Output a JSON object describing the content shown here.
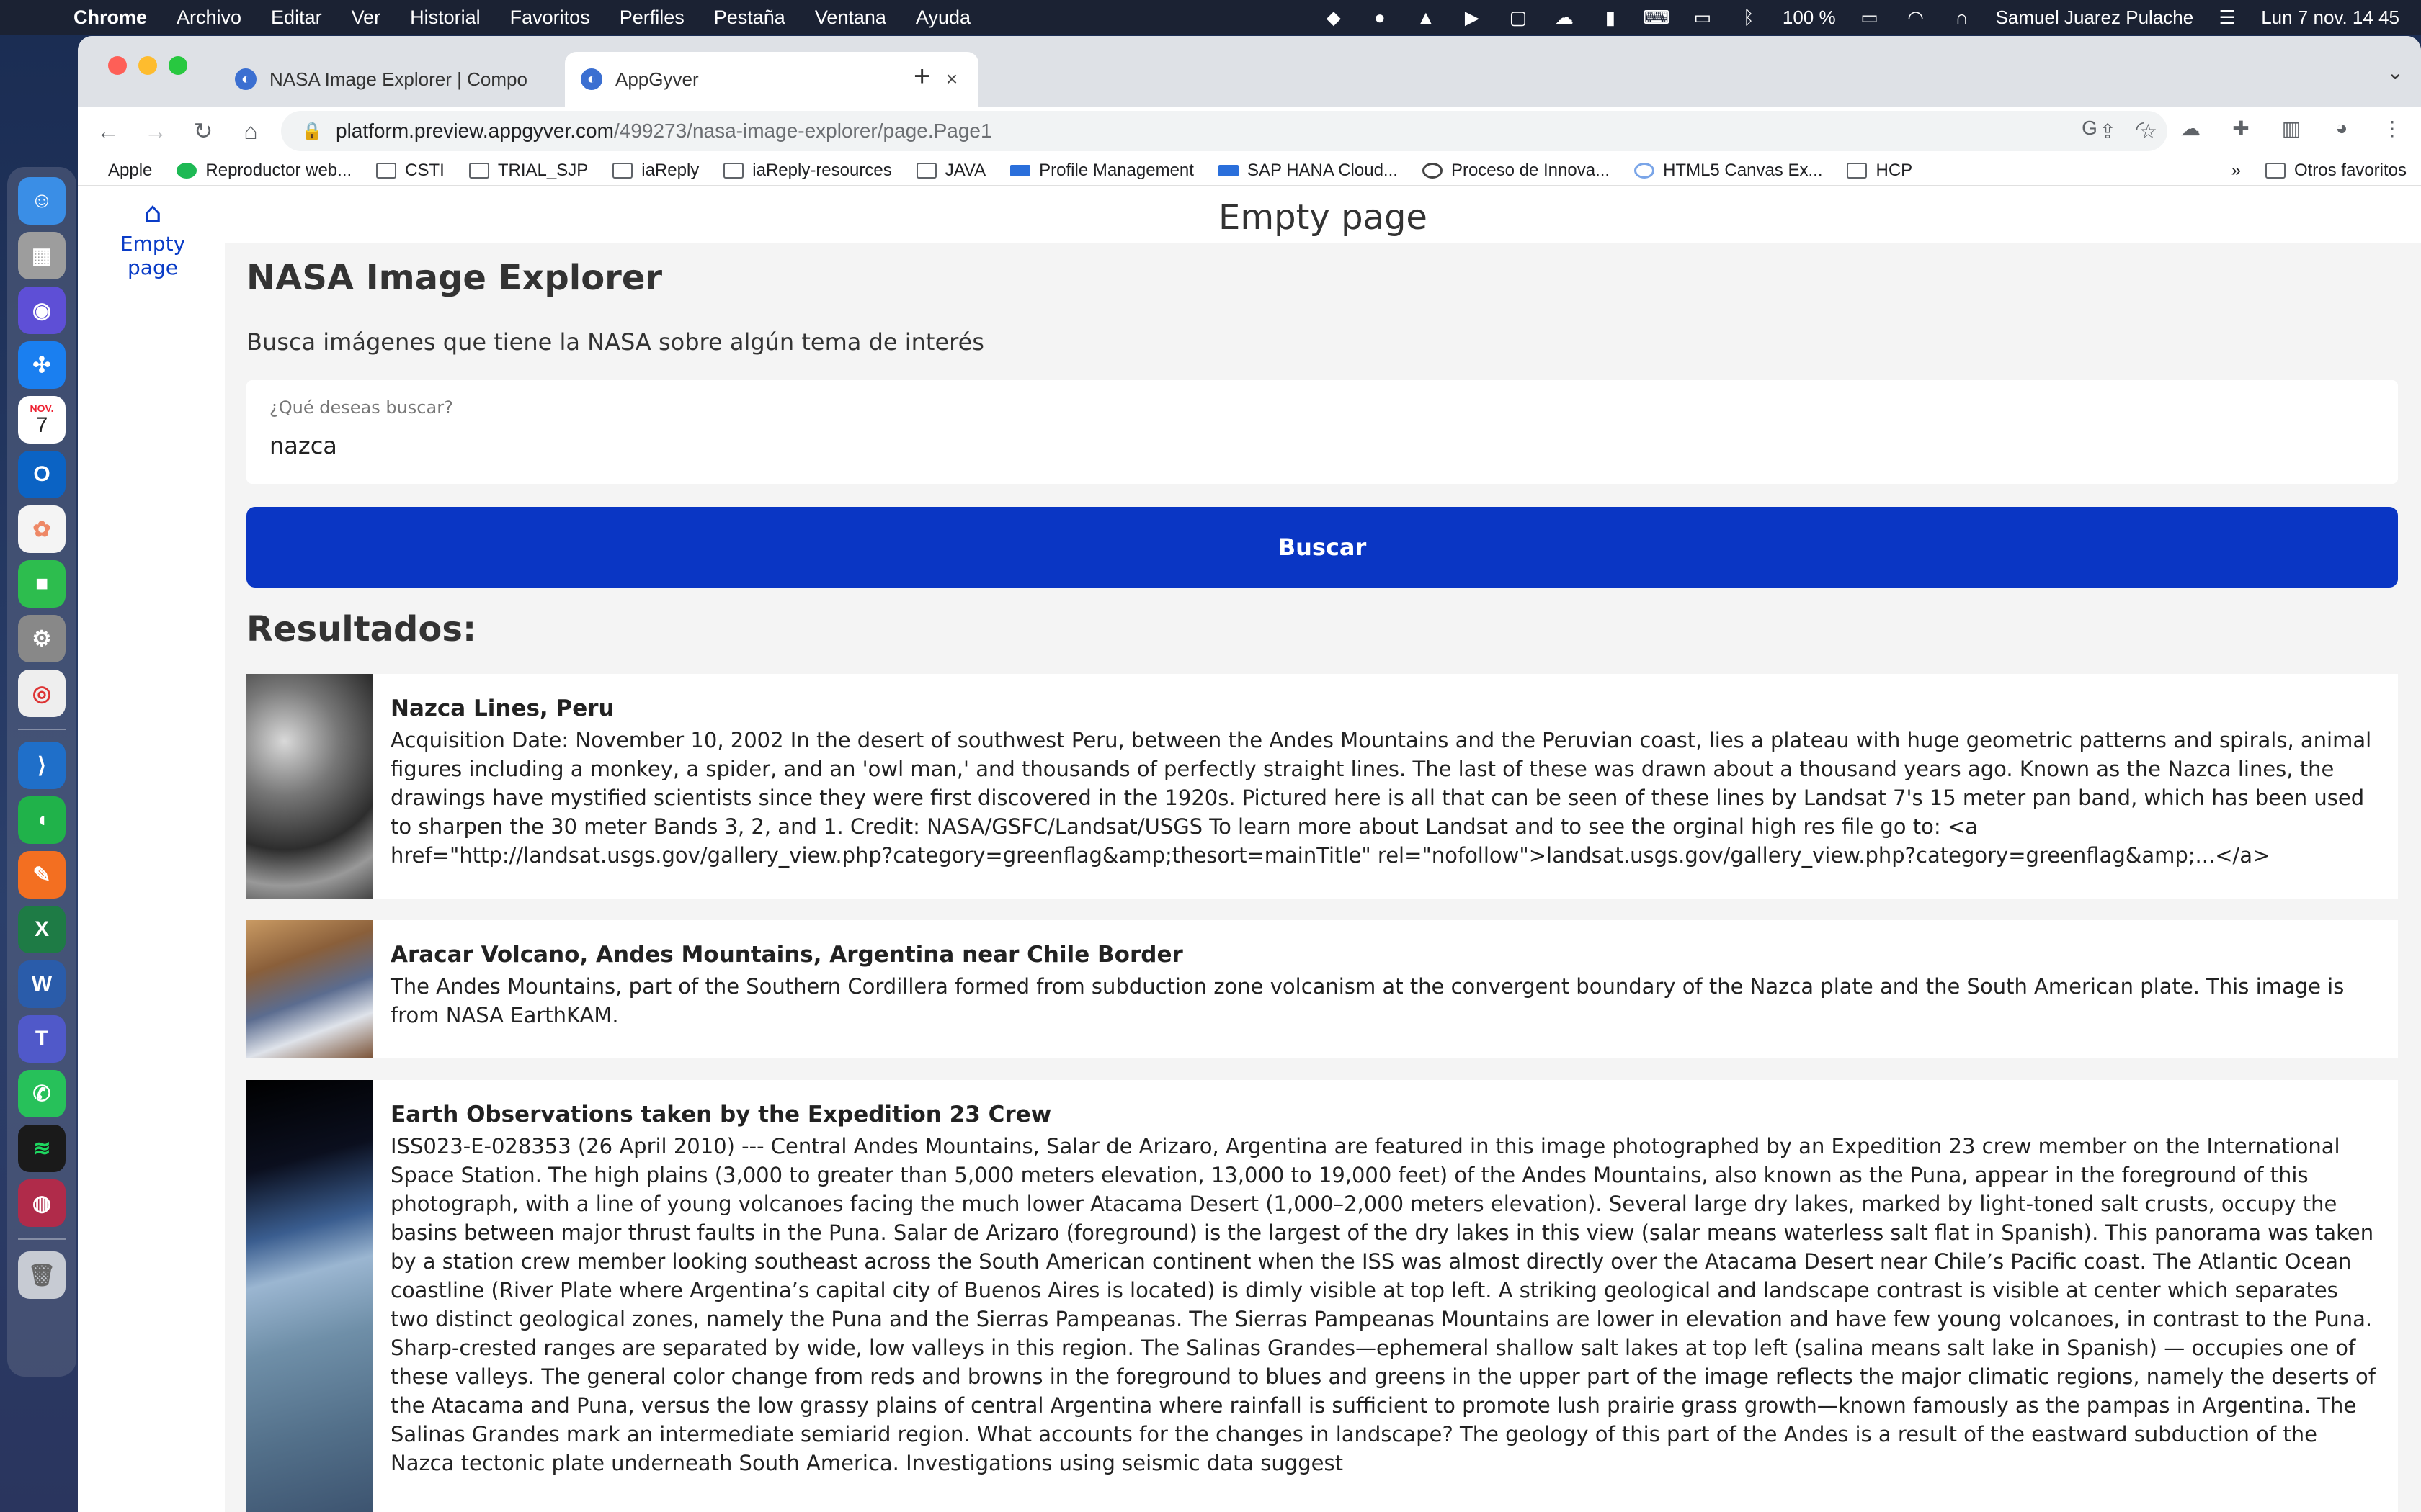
{
  "menubar": {
    "items": [
      "Chrome",
      "Archivo",
      "Editar",
      "Ver",
      "Historial",
      "Favoritos",
      "Perfiles",
      "Pestaña",
      "Ventana",
      "Ayuda"
    ],
    "battery": "100 %",
    "user": "Samuel Juarez Pulache",
    "datetime": "Lun 7 nov.  14 45"
  },
  "dock": {
    "calendar_month": "NOV.",
    "calendar_day": "7"
  },
  "browser": {
    "tabs": [
      {
        "title": "NASA Image Explorer | Compo",
        "active": false
      },
      {
        "title": "AppGyver",
        "active": true
      }
    ],
    "url_host": "platform.preview.appgyver.com",
    "url_path": "/499273/nasa-image-explorer/page.Page1",
    "bookmarks": [
      "Apple",
      "Reproductor web...",
      "CSTI",
      "TRIAL_SJP",
      "iaReply",
      "iaReply-resources",
      "JAVA",
      "Profile Management",
      "SAP HANA Cloud...",
      "Proceso de Innova...",
      "HTML5 Canvas Ex...",
      "HCP"
    ],
    "bookmarks_more": "»",
    "other_bookmarks": "Otros favoritos"
  },
  "app": {
    "nav_home_label": "Empty page",
    "page_title": "Empty page",
    "heading": "NASA Image Explorer",
    "subtitle": "Busca imágenes que tiene la NASA sobre algún tema de interés",
    "search_label": "¿Qué deseas buscar?",
    "search_value": "nazca",
    "search_button": "Buscar",
    "results_heading": "Resultados:",
    "results": [
      {
        "title": "Nazca Lines, Peru",
        "description": "Acquisition Date: November 10, 2002   In the desert of southwest Peru, between the Andes Mountains and the Peruvian coast, lies a plateau with huge geometric patterns and spirals, animal figures including a monkey, a spider, and an 'owl man,' and thousands of perfectly straight lines. The last of these was drawn about a thousand years ago. Known as the Nazca lines, the drawings have mystified scientists since they were first discovered in the 1920s. Pictured here is all that can be seen of these lines by Landsat 7's 15 meter pan band, which has been used to sharpen the 30 meter Bands 3, 2, and 1.   Credit:  NASA/GSFC/Landsat/USGS  To learn more about Landsat and to see the orginal high res file go to:  <a href=\"http://landsat.usgs.gov/gallery_view.php?category=greenflag&amp;thesort=mainTitle\" rel=\"nofollow\">landsat.usgs.gov/gallery_view.php?category=greenflag&amp;...</a>"
      },
      {
        "title": "Aracar Volcano, Andes Mountains, Argentina near Chile Border",
        "description": "The Andes Mountains, part of the Southern Cordillera formed from subduction zone volcanism at the convergent boundary of the Nazca plate and the South American plate. This image is from NASA EarthKAM."
      },
      {
        "title": "Earth Observations taken by the Expedition 23 Crew",
        "description": "ISS023-E-028353 (26 April 2010) --- Central Andes Mountains, Salar de Arizaro, Argentina are featured in this image photographed by an Expedition 23 crew member on the International Space Station. The high plains (3,000 to greater than 5,000 meters elevation, 13,000 to 19,000 feet) of the Andes Mountains, also known as the Puna, appear in the foreground of this photograph, with a line of young volcanoes facing the much lower Atacama Desert (1,000–2,000 meters elevation). Several large dry lakes, marked by light-toned salt crusts, occupy the basins between major thrust faults in the Puna. Salar de Arizaro (foreground) is the largest of the dry lakes in this view (salar means waterless salt flat in Spanish). This panorama was taken by a station crew member looking southeast across the South American continent when the ISS was almost directly over the Atacama Desert near Chile’s Pacific coast. The Atlantic Ocean coastline (River Plate where Argentina’s capital city of Buenos Aires is located) is dimly visible at top left. A striking geological and landscape contrast is visible at center which separates two distinct geological zones, namely the Puna and the Sierras Pampeanas. The Sierras Pampeanas Mountains are lower in elevation and have few young volcanoes, in contrast to the Puna. Sharp-crested ranges are separated by wide, low valleys in this region. The Salinas Grandes—ephemeral shallow salt lakes at top left (salina means salt lake in Spanish) — occupies one of these valleys. The general color change from reds and browns in the foreground to blues and greens in the upper part of the image reflects the major climatic regions, namely the deserts of the Atacama and Puna, versus the low grassy plains of central Argentina where rainfall is sufficient to promote lush prairie grass growth—known famously as the pampas in Argentina. The Salinas Grandes mark an intermediate semiarid region. What accounts for the changes in landscape? The geology of this part of the Andes is a result of the eastward subduction of the Nazca tectonic plate underneath South America. Investigations using seismic data suggest"
      }
    ]
  },
  "colors": {
    "primary_button": "#0a36c4",
    "nav_link": "#0a3cc7",
    "page_background": "#f4f4f4"
  }
}
